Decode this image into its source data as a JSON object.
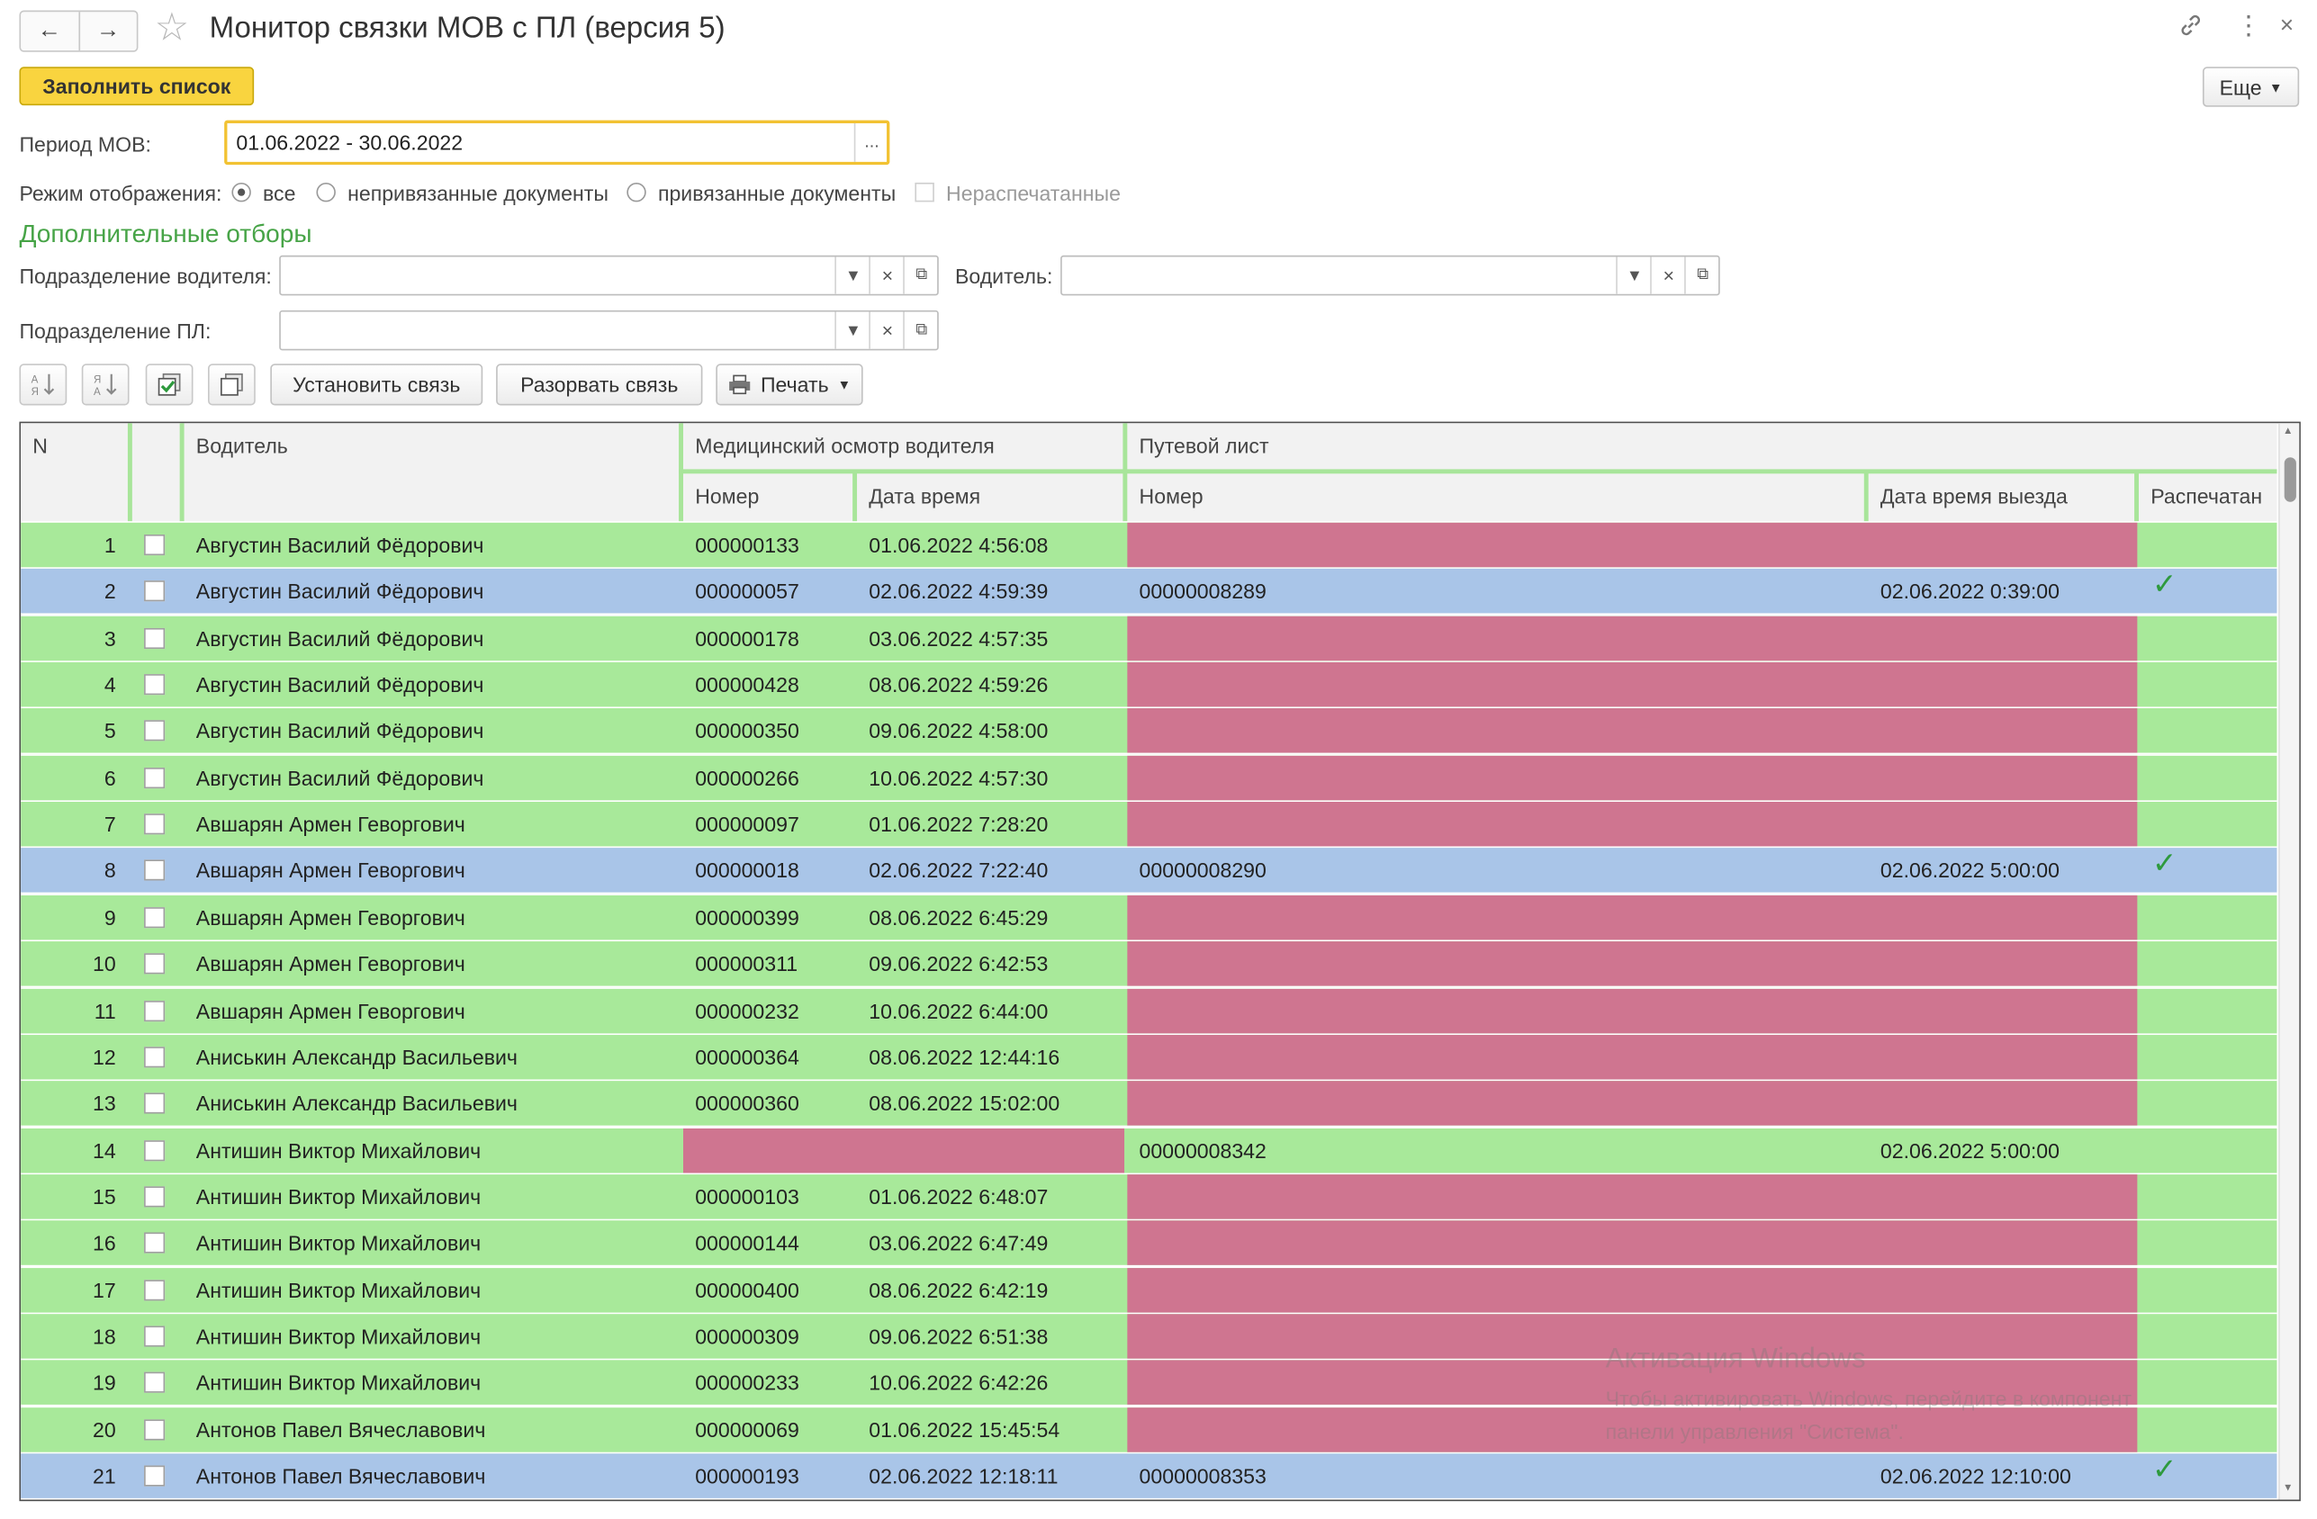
{
  "window": {
    "title": "Монитор связки МОВ с ПЛ (версия 5)"
  },
  "toolbar": {
    "fill_button": "Заполнить список",
    "more_button": "Еще"
  },
  "filters": {
    "period_label": "Период МОВ:",
    "period_value": "01.06.2022 - 30.06.2022",
    "period_button": "...",
    "mode_label": "Режим отображения:",
    "mode_options": [
      "все",
      "непривязанные документы",
      "привязанные документы"
    ],
    "mode_selected": "все",
    "unprinted_label": "Нераспечатанные",
    "section_title": "Дополнительные отборы",
    "driver_division_label": "Подразделение водителя:",
    "driver_label": "Водитель:",
    "pl_division_label": "Подразделение ПЛ:"
  },
  "table_toolbar": {
    "link_button": "Установить связь",
    "unlink_button": "Разорвать связь",
    "print_button": "Печать"
  },
  "table": {
    "headers": {
      "n": "N",
      "driver": "Водитель",
      "med_group": "Медицинский осмотр водителя",
      "med_number": "Номер",
      "med_datetime": "Дата время",
      "waybill_group": "Путевой лист",
      "waybill_number": "Номер",
      "waybill_datetime": "Дата время выезда",
      "printed": "Распечатан"
    },
    "rows": [
      {
        "n": "1",
        "driver": "Августин Василий Фёдорович",
        "med_number": "000000133",
        "med_datetime": "01.06.2022 4:56:08",
        "waybill_number": "",
        "waybill_datetime": "",
        "printed": false,
        "selected": false
      },
      {
        "n": "2",
        "driver": "Августин Василий Фёдорович",
        "med_number": "000000057",
        "med_datetime": "02.06.2022 4:59:39",
        "waybill_number": "00000008289",
        "waybill_datetime": "02.06.2022 0:39:00",
        "printed": true,
        "selected": true
      },
      {
        "n": "3",
        "driver": "Августин Василий Фёдорович",
        "med_number": "000000178",
        "med_datetime": "03.06.2022 4:57:35",
        "waybill_number": "",
        "waybill_datetime": "",
        "printed": false,
        "selected": false
      },
      {
        "n": "4",
        "driver": "Августин Василий Фёдорович",
        "med_number": "000000428",
        "med_datetime": "08.06.2022 4:59:26",
        "waybill_number": "",
        "waybill_datetime": "",
        "printed": false,
        "selected": false
      },
      {
        "n": "5",
        "driver": "Августин Василий Фёдорович",
        "med_number": "000000350",
        "med_datetime": "09.06.2022 4:58:00",
        "waybill_number": "",
        "waybill_datetime": "",
        "printed": false,
        "selected": false
      },
      {
        "n": "6",
        "driver": "Августин Василий Фёдорович",
        "med_number": "000000266",
        "med_datetime": "10.06.2022 4:57:30",
        "waybill_number": "",
        "waybill_datetime": "",
        "printed": false,
        "selected": false
      },
      {
        "n": "7",
        "driver": "Авшарян Армен Геворгович",
        "med_number": "000000097",
        "med_datetime": "01.06.2022 7:28:20",
        "waybill_number": "",
        "waybill_datetime": "",
        "printed": false,
        "selected": false
      },
      {
        "n": "8",
        "driver": "Авшарян Армен Геворгович",
        "med_number": "000000018",
        "med_datetime": "02.06.2022 7:22:40",
        "waybill_number": "00000008290",
        "waybill_datetime": "02.06.2022 5:00:00",
        "printed": true,
        "selected": true
      },
      {
        "n": "9",
        "driver": "Авшарян Армен Геворгович",
        "med_number": "000000399",
        "med_datetime": "08.06.2022 6:45:29",
        "waybill_number": "",
        "waybill_datetime": "",
        "printed": false,
        "selected": false
      },
      {
        "n": "10",
        "driver": "Авшарян Армен Геворгович",
        "med_number": "000000311",
        "med_datetime": "09.06.2022 6:42:53",
        "waybill_number": "",
        "waybill_datetime": "",
        "printed": false,
        "selected": false
      },
      {
        "n": "11",
        "driver": "Авшарян Армен Геворгович",
        "med_number": "000000232",
        "med_datetime": "10.06.2022 6:44:00",
        "waybill_number": "",
        "waybill_datetime": "",
        "printed": false,
        "selected": false
      },
      {
        "n": "12",
        "driver": "Аниськин Александр Васильевич",
        "med_number": "000000364",
        "med_datetime": "08.06.2022 12:44:16",
        "waybill_number": "",
        "waybill_datetime": "",
        "printed": false,
        "selected": false
      },
      {
        "n": "13",
        "driver": "Аниськин Александр Васильевич",
        "med_number": "000000360",
        "med_datetime": "08.06.2022 15:02:00",
        "waybill_number": "",
        "waybill_datetime": "",
        "printed": false,
        "selected": false
      },
      {
        "n": "14",
        "driver": "Антишин Виктор Михайлович",
        "med_number": "",
        "med_datetime": "",
        "waybill_number": "00000008342",
        "waybill_datetime": "02.06.2022 5:00:00",
        "printed": false,
        "selected": false
      },
      {
        "n": "15",
        "driver": "Антишин Виктор Михайлович",
        "med_number": "000000103",
        "med_datetime": "01.06.2022 6:48:07",
        "waybill_number": "",
        "waybill_datetime": "",
        "printed": false,
        "selected": false
      },
      {
        "n": "16",
        "driver": "Антишин Виктор Михайлович",
        "med_number": "000000144",
        "med_datetime": "03.06.2022 6:47:49",
        "waybill_number": "",
        "waybill_datetime": "",
        "printed": false,
        "selected": false
      },
      {
        "n": "17",
        "driver": "Антишин Виктор Михайлович",
        "med_number": "000000400",
        "med_datetime": "08.06.2022 6:42:19",
        "waybill_number": "",
        "waybill_datetime": "",
        "printed": false,
        "selected": false
      },
      {
        "n": "18",
        "driver": "Антишин Виктор Михайлович",
        "med_number": "000000309",
        "med_datetime": "09.06.2022 6:51:38",
        "waybill_number": "",
        "waybill_datetime": "",
        "printed": false,
        "selected": false
      },
      {
        "n": "19",
        "driver": "Антишин Виктор Михайлович",
        "med_number": "000000233",
        "med_datetime": "10.06.2022 6:42:26",
        "waybill_number": "",
        "waybill_datetime": "",
        "printed": false,
        "selected": false
      },
      {
        "n": "20",
        "driver": "Антонов Павел Вячеславович",
        "med_number": "000000069",
        "med_datetime": "01.06.2022 15:45:54",
        "waybill_number": "",
        "waybill_datetime": "",
        "printed": false,
        "selected": false
      },
      {
        "n": "21",
        "driver": "Антонов Павел Вячеславович",
        "med_number": "000000193",
        "med_datetime": "02.06.2022 12:18:11",
        "waybill_number": "00000008353",
        "waybill_datetime": "02.06.2022 12:10:00",
        "printed": true,
        "selected": true
      }
    ]
  },
  "watermark": {
    "line1": "Активация Windows",
    "line2": "Чтобы активировать Windows, перейдите в компонент",
    "line3": "панели управления \"Система\"."
  },
  "colors": {
    "row_green": "#a8e99a",
    "row_selected": "#a9c5e8",
    "missing_pink": "#cf7590",
    "accent_yellow": "#f9d43f",
    "section_green": "#47a447",
    "check_green": "#2e9a3e"
  }
}
